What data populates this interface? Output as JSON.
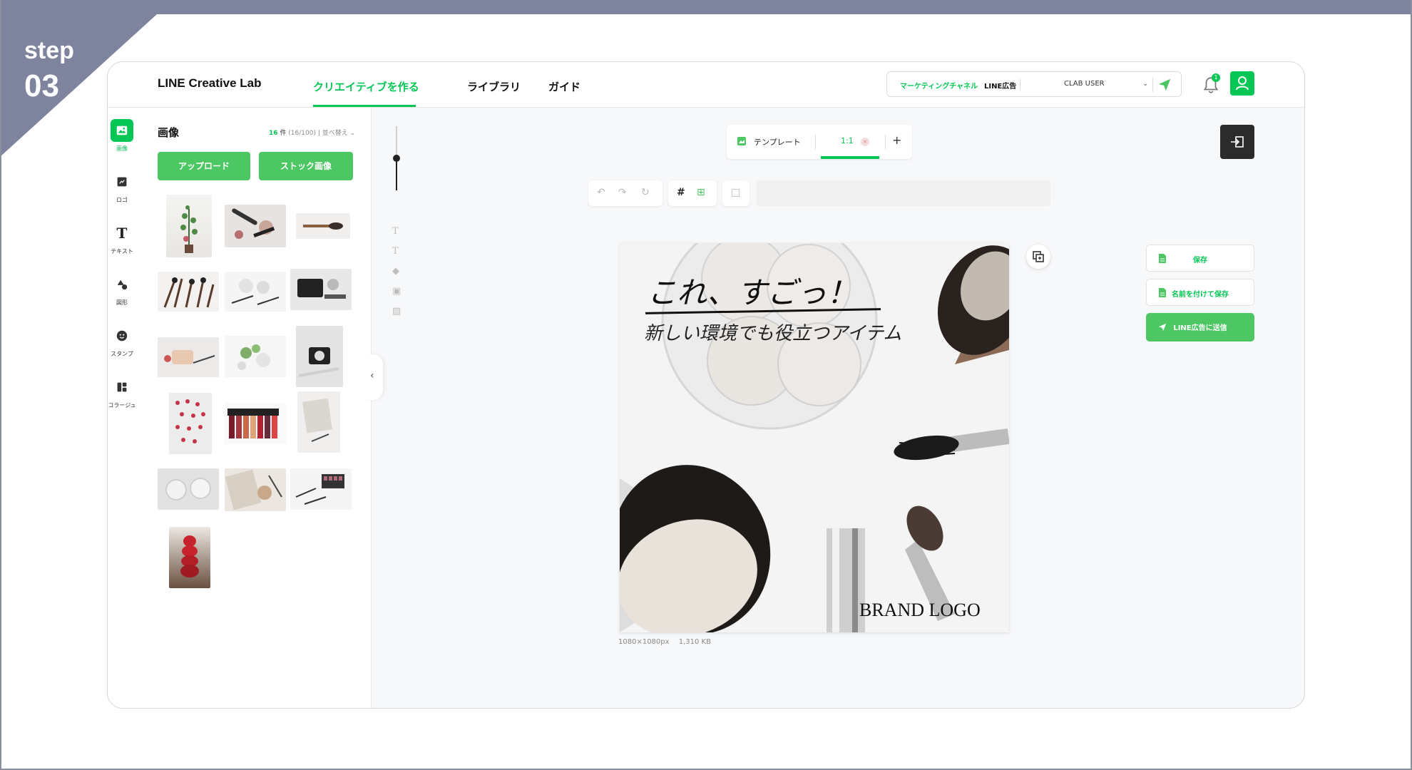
{
  "step": {
    "word": "step",
    "number": "03"
  },
  "header": {
    "logo": "LINE Creative Lab",
    "nav": [
      {
        "label": "クリエイティブを作る",
        "active": true
      },
      {
        "label": "ライブラリ",
        "active": false
      },
      {
        "label": "ガイド",
        "active": false
      }
    ],
    "channel_label": "マーケティングチャネル",
    "channel_value": "LINE広告",
    "user": "CLAB USER",
    "notification_count": "1"
  },
  "sidebar": {
    "items": [
      {
        "label": "画像",
        "icon": "image-icon",
        "active": true
      },
      {
        "label": "ロゴ",
        "icon": "logo-icon",
        "active": false
      },
      {
        "label": "テキスト",
        "icon": "text-icon",
        "active": false
      },
      {
        "label": "図形",
        "icon": "shape-icon",
        "active": false
      },
      {
        "label": "スタンプ",
        "icon": "sticker-icon",
        "active": false
      },
      {
        "label": "コラージュ",
        "icon": "collage-icon",
        "active": false
      }
    ]
  },
  "panel": {
    "title": "画像",
    "count": "16",
    "count_unit": "件",
    "count_detail": "(16/100)",
    "sort_label": "並べ替え",
    "upload_label": "アップロード",
    "stock_label": "ストック画像"
  },
  "tabs": {
    "template_label": "テンプレート",
    "ratio_label": "1:1"
  },
  "canvas": {
    "headline": "これ、すごっ！",
    "subheadline": "新しい環境でも役立つアイテム",
    "brand": "BRAND LOGO",
    "size": "1080×1080px",
    "filesize": "1,310 KB"
  },
  "actions": {
    "save": "保存",
    "save_as": "名前を付けて保存",
    "send": "LINE広告に送信"
  },
  "colors": {
    "accent": "#06c755",
    "badge": "#7f849e"
  }
}
